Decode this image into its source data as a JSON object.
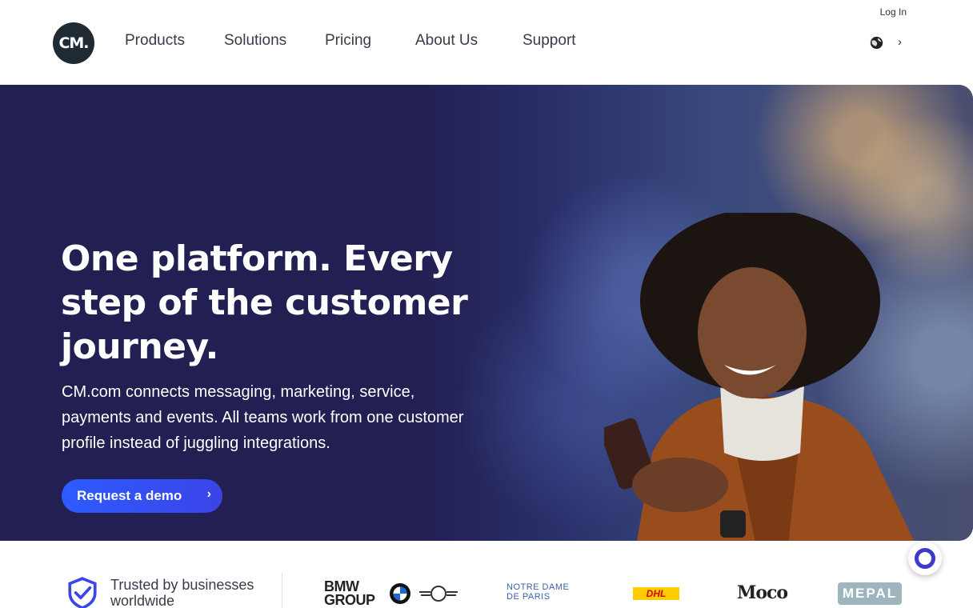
{
  "header": {
    "logo_text": "CM.",
    "nav": [
      "Products",
      "Solutions",
      "Pricing",
      "About Us",
      "Support"
    ],
    "login_label": "Log In",
    "language_icon": "globe-icon",
    "language_chevron": "›"
  },
  "hero": {
    "title": "One platform. Every step of the customer journey.",
    "subtitle": "CM.com connects messaging, marketing, service, payments and events. All teams work from one customer profile instead of juggling integrations.",
    "cta_label": "Request a demo",
    "cta_chevron": "›"
  },
  "trust": {
    "text": "Trusted by businesses worldwide",
    "brands": {
      "bmw": "BMW GROUP",
      "notre_dame": "NOTRE DAME DE PARIS",
      "dhl": "DHL",
      "moco": "Moco",
      "mepal": "MEPAL"
    }
  },
  "colors": {
    "hero_bg": "#221f52",
    "cta": "#2d5bff",
    "logo_bg": "#1f2a33",
    "chat_ring": "#3e3acb"
  }
}
